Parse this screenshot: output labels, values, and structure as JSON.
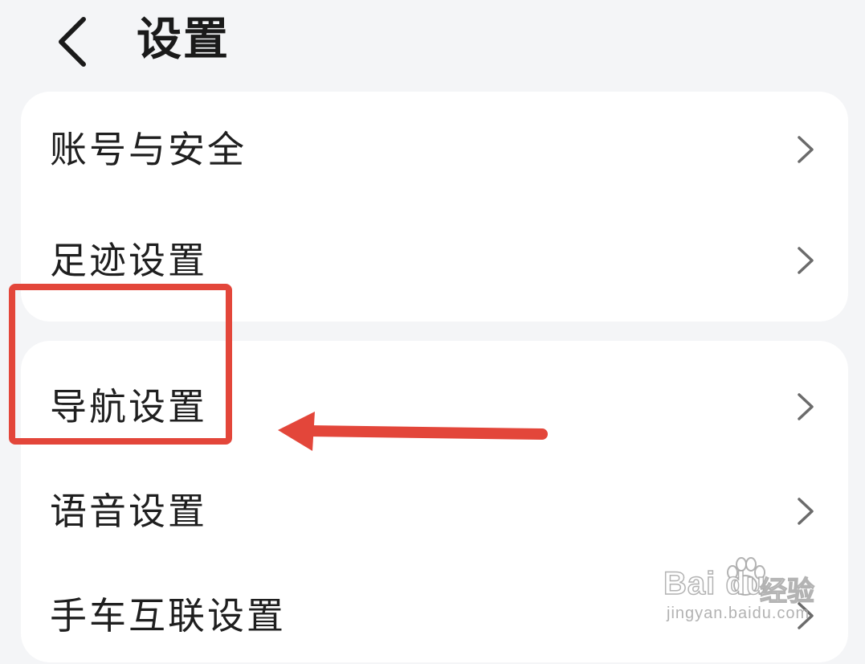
{
  "header": {
    "title": "设置",
    "back_icon": "chevron-left-icon"
  },
  "groups": [
    {
      "items": [
        {
          "label": "账号与安全",
          "icon": "chevron-right-icon"
        },
        {
          "label": "足迹设置",
          "icon": "chevron-right-icon"
        }
      ]
    },
    {
      "items": [
        {
          "label": "导航设置",
          "icon": "chevron-right-icon"
        },
        {
          "label": "语音设置",
          "icon": "chevron-right-icon"
        },
        {
          "label": "手车互联设置",
          "icon": "chevron-right-icon"
        }
      ]
    }
  ],
  "annotation": {
    "highlight_color": "#e3463a",
    "highlighted_item": "导航设置"
  },
  "watermark": {
    "logo": "Bai du",
    "brand_cn": "经验",
    "url": "jingyan.baidu.com"
  },
  "colors": {
    "background": "#f4f5f7",
    "card": "#ffffff",
    "text": "#1f1f1f",
    "chevron": "#6b6b6b"
  }
}
